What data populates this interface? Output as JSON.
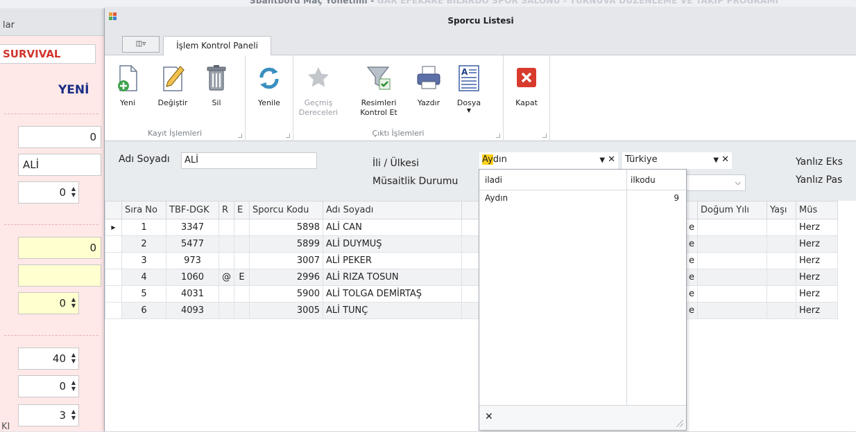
{
  "bg": {
    "title_dark": "Sbantbord Maç Yönetimi -",
    "title_faded": " GAR EFEKARE BİLARDO SPOR SALONU - TURNUVA DÜZENLEME VE TAKİP PROGRAMI",
    "header_text": "lar",
    "tab_label": "SURVIVAL",
    "yeni_label": "YENİ",
    "field_1": "0",
    "field_name": "ALİ",
    "field_spin_1": "0",
    "field_yellow_1": "0",
    "field_yellow_2": "",
    "field_spin_2": "0",
    "field_spin_3": "40",
    "field_spin_4": "0",
    "field_spin_5": "3",
    "small_label": "KI"
  },
  "dialog": {
    "title": "Sporcu Listesi",
    "qa_label": "◫▿",
    "tab_label": "İşlem Kontrol Paneli",
    "groups": {
      "kayit": "Kayıt İşlemleri",
      "cikti": "Çıktı İşlemleri"
    },
    "buttons": {
      "yeni": "Yeni",
      "degistir": "Değiştir",
      "sil": "Sil",
      "yenile": "Yenile",
      "gecmis_1": "Geçmiş",
      "gecmis_2": "Dereceleri",
      "resimleri_1": "Resimleri",
      "resimleri_2": "Kontrol Et",
      "yazdir": "Yazdır",
      "dosya": "Dosya",
      "kapat": "Kapat"
    }
  },
  "filters": {
    "name_label": "Adı Soyadı",
    "name_value": "ALİ",
    "city_label": "İli / Ülkesi",
    "city_value_hl": "Ay",
    "city_value_rest": "dın",
    "country_value": "Türkiye",
    "avail_label": "Müsaitlik Durumu",
    "opt1_label": "Yanlız Eks",
    "opt2_label": "Yanlız Pas"
  },
  "popup": {
    "col1": "iladi",
    "col2": "ilkodu",
    "row_name": "Aydın",
    "row_code": "9"
  },
  "grid": {
    "headers": [
      "Sıra No",
      "TBF-DGK",
      "R",
      "E",
      "Sporcu Kodu",
      "Adı Soyadı",
      "",
      "Doğum Yılı",
      "Yaşı",
      "Müs"
    ],
    "rows": [
      {
        "sira": "1",
        "tbf": "3347",
        "r": "",
        "e": "",
        "kod": "5898",
        "ad": "ALİ CAN",
        "cut": "e",
        "mus": "Herz"
      },
      {
        "sira": "2",
        "tbf": "5477",
        "r": "",
        "e": "",
        "kod": "5899",
        "ad": "ALİ DUYMUŞ",
        "cut": "e",
        "mus": "Herz"
      },
      {
        "sira": "3",
        "tbf": "973",
        "r": "",
        "e": "",
        "kod": "3007",
        "ad": "ALİ PEKER",
        "cut": "e",
        "mus": "Herz"
      },
      {
        "sira": "4",
        "tbf": "1060",
        "r": "@",
        "e": "E",
        "kod": "2996",
        "ad": "ALİ RIZA TOSUN",
        "cut": "e",
        "mus": "Herz"
      },
      {
        "sira": "5",
        "tbf": "4031",
        "r": "",
        "e": "",
        "kod": "5900",
        "ad": "ALİ TOLGA DEMİRTAŞ",
        "cut": "e",
        "mus": "Herz"
      },
      {
        "sira": "6",
        "tbf": "4093",
        "r": "",
        "e": "",
        "kod": "3005",
        "ad": "ALİ TUNÇ",
        "cut": "e",
        "mus": "Herz"
      }
    ]
  }
}
